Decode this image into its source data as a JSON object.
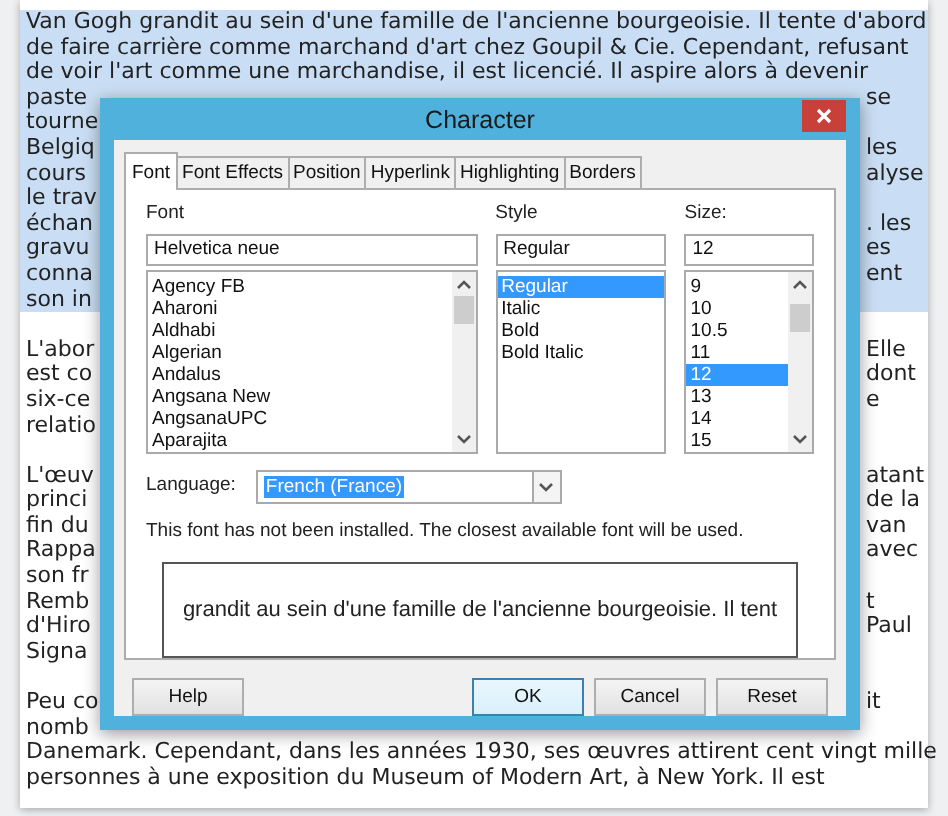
{
  "document": {
    "paragraphs": [
      {
        "lines": [
          {
            "left": "Van Gogh grandit au sein d'une famille de l'ancienne bourgeoisie. Il tente d'abord",
            "selected": true
          },
          {
            "left": "de faire carrière comme marchand d'art chez Goupil & Cie. Cependant, refusant",
            "selected": true
          },
          {
            "left": "de voir l'art comme une marchandise, il est licencié. Il aspire alors à devenir",
            "selected": true
          },
          {
            "left": "paste",
            "right": "se",
            "selected": true
          },
          {
            "left": "tourne",
            "selected": true
          },
          {
            "left": "Belgiq",
            "right": "les",
            "selected": true
          },
          {
            "left": "cours",
            "right": "alyse",
            "selected": true
          },
          {
            "left": "le trav",
            "selected": true
          },
          {
            "left": "échan",
            "right": ". les",
            "selected": true
          },
          {
            "left": "gravu",
            "right": "es",
            "selected": true
          },
          {
            "left": "conna",
            "right": "ent",
            "selected": true
          },
          {
            "left": "son in",
            "selected": true
          }
        ]
      },
      {
        "lines": [
          {
            "left": "L'abor",
            "right": "Elle",
            "selected": false
          },
          {
            "left": "est co",
            "right": "dont",
            "selected": false
          },
          {
            "left": "six-ce",
            "right": "e",
            "selected": false
          },
          {
            "left": "relatio",
            "selected": false
          }
        ]
      },
      {
        "lines": [
          {
            "left": "L'œuv",
            "right": "atant",
            "selected": false
          },
          {
            "left": "princi",
            "right": "de la",
            "selected": false
          },
          {
            "left": "fin du",
            "right": "van",
            "selected": false
          },
          {
            "left": "Rappa",
            "right": "avec",
            "selected": false
          },
          {
            "left": "son fr",
            "selected": false
          },
          {
            "left": "Remb",
            "right": "t",
            "selected": false
          },
          {
            "left": "d'Hiro",
            "right": "Paul",
            "selected": false
          },
          {
            "left": "Signa",
            "selected": false
          }
        ]
      },
      {
        "lines": [
          {
            "left": "Peu co",
            "right": "it",
            "selected": false
          },
          {
            "left": "nomb",
            "selected": false
          },
          {
            "left": "Danemark. Cependant, dans les années 1930, ses œuvres attirent cent vingt mille",
            "selected": false
          },
          {
            "left": "personnes à une exposition du Museum of Modern Art, à New York. Il est",
            "selected": false
          }
        ]
      }
    ]
  },
  "dialog": {
    "title": "Character",
    "tabs": [
      {
        "label": "Font",
        "selected": true
      },
      {
        "label": "Font Effects",
        "selected": false
      },
      {
        "label": "Position",
        "selected": false
      },
      {
        "label": "Hyperlink",
        "selected": false
      },
      {
        "label": "Highlighting",
        "selected": false
      },
      {
        "label": "Borders",
        "selected": false
      }
    ],
    "font": {
      "label": "Font",
      "value": "Helvetica neue",
      "items": [
        {
          "text": "Agency FB",
          "selected": false
        },
        {
          "text": "Aharoni",
          "selected": false
        },
        {
          "text": "Aldhabi",
          "selected": false
        },
        {
          "text": "Algerian",
          "selected": false
        },
        {
          "text": "Andalus",
          "selected": false
        },
        {
          "text": "Angsana New",
          "selected": false
        },
        {
          "text": "AngsanaUPC",
          "selected": false
        },
        {
          "text": "Aparajita",
          "selected": false
        }
      ]
    },
    "style": {
      "label": "Style",
      "value": "Regular",
      "items": [
        {
          "text": "Regular",
          "selected": true
        },
        {
          "text": "Italic",
          "selected": false
        },
        {
          "text": "Bold",
          "selected": false
        },
        {
          "text": "Bold Italic",
          "selected": false
        }
      ]
    },
    "size": {
      "label": "Size:",
      "value": "12",
      "items": [
        {
          "text": "9",
          "selected": false
        },
        {
          "text": "10",
          "selected": false
        },
        {
          "text": "10.5",
          "selected": false
        },
        {
          "text": "11",
          "selected": false
        },
        {
          "text": "12",
          "selected": true
        },
        {
          "text": "13",
          "selected": false
        },
        {
          "text": "14",
          "selected": false
        },
        {
          "text": "15",
          "selected": false
        }
      ]
    },
    "language": {
      "label": "Language:",
      "value": "French (France)"
    },
    "note": "This font has not been installed. The closest available font will be used.",
    "preview": "grandit au sein d'une famille de l'ancienne bourgeoisie. Il tent",
    "buttons": [
      {
        "label": "Help",
        "kind": "plain"
      },
      {
        "label": "OK",
        "kind": "default"
      },
      {
        "label": "Cancel",
        "kind": "plain"
      },
      {
        "label": "Reset",
        "kind": "plain"
      }
    ]
  }
}
